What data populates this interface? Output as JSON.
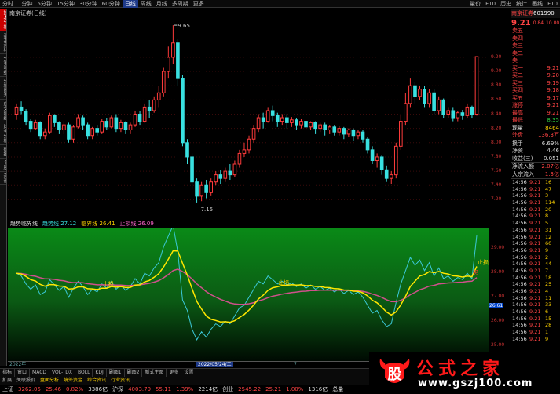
{
  "topbar": {
    "menu": [
      "分时",
      "1分钟",
      "5分钟",
      "15分钟",
      "30分钟",
      "60分钟",
      "日线",
      "周线",
      "月线",
      "多周期",
      "更多"
    ],
    "active": "日线",
    "right": [
      "量价",
      "F10",
      "历史",
      "统计",
      "画线",
      "F10"
    ]
  },
  "left_nav": [
    "技术分析",
    "基本资料",
    "分笔明细",
    "分析图表",
    "成交明细",
    "财务分析",
    "研报",
    "个股",
    "资讯"
  ],
  "left_nav_active": "技术分析",
  "chart": {
    "title": "南京证券(日线)",
    "price_labels": [
      "9.20",
      "9.00",
      "8.80",
      "8.60",
      "8.40",
      "8.20",
      "8.00",
      "7.80",
      "7.60",
      "7.40",
      "7.20"
    ],
    "high_label": "9.65",
    "low_label": "7.15",
    "candles": [
      [
        8.4,
        8.5,
        8.32,
        8.55
      ],
      [
        8.5,
        8.45,
        8.4,
        8.58
      ],
      [
        8.44,
        8.3,
        8.25,
        8.47
      ],
      [
        8.3,
        8.2,
        8.15,
        8.33
      ],
      [
        8.2,
        8.28,
        8.18,
        8.32
      ],
      [
        8.28,
        8.1,
        8.05,
        8.3
      ],
      [
        8.1,
        8.15,
        8.05,
        8.2
      ],
      [
        8.15,
        8.38,
        8.12,
        8.42
      ],
      [
        8.38,
        8.28,
        8.22,
        8.4
      ],
      [
        8.28,
        8.18,
        8.12,
        8.3
      ],
      [
        8.18,
        8.25,
        8.12,
        8.3
      ],
      [
        8.25,
        8.05,
        8.0,
        8.28
      ],
      [
        8.05,
        8.22,
        8.0,
        8.25
      ],
      [
        8.22,
        8.35,
        8.2,
        8.4
      ],
      [
        8.35,
        8.25,
        8.18,
        8.38
      ],
      [
        8.25,
        8.1,
        8.05,
        8.28
      ],
      [
        8.1,
        8.2,
        8.05,
        8.22
      ],
      [
        8.2,
        8.15,
        8.1,
        8.25
      ],
      [
        8.15,
        8.3,
        8.12,
        8.33
      ],
      [
        8.3,
        8.22,
        8.18,
        8.35
      ],
      [
        8.22,
        8.35,
        8.2,
        8.38
      ],
      [
        8.35,
        8.2,
        8.15,
        8.4
      ],
      [
        8.2,
        8.28,
        8.15,
        8.32
      ],
      [
        8.28,
        8.18,
        8.12,
        8.3
      ],
      [
        8.18,
        8.25,
        8.12,
        8.28
      ],
      [
        8.25,
        8.4,
        8.22,
        8.45
      ],
      [
        8.4,
        8.3,
        8.25,
        8.45
      ],
      [
        8.3,
        8.5,
        8.28,
        8.55
      ],
      [
        8.5,
        8.45,
        8.35,
        8.6
      ],
      [
        8.45,
        8.6,
        8.42,
        8.65
      ],
      [
        8.6,
        8.7,
        8.5,
        8.8
      ],
      [
        8.7,
        9.0,
        8.65,
        9.05
      ],
      [
        9.0,
        9.2,
        8.9,
        9.35
      ],
      [
        9.2,
        9.4,
        9.1,
        9.65
      ],
      [
        9.4,
        8.9,
        8.8,
        9.45
      ],
      [
        8.9,
        8.0,
        7.95,
        8.95
      ],
      [
        8.0,
        7.8,
        7.7,
        8.05
      ],
      [
        7.8,
        7.45,
        7.35,
        7.85
      ],
      [
        7.45,
        7.25,
        7.15,
        7.5
      ],
      [
        7.25,
        7.4,
        7.18,
        7.45
      ],
      [
        7.4,
        7.3,
        7.22,
        7.48
      ],
      [
        7.3,
        7.45,
        7.25,
        7.5
      ],
      [
        7.45,
        7.55,
        7.4,
        7.6
      ],
      [
        7.55,
        7.5,
        7.42,
        7.62
      ],
      [
        7.5,
        7.6,
        7.45,
        7.65
      ],
      [
        7.6,
        7.55,
        7.48,
        7.7
      ],
      [
        7.55,
        7.7,
        7.52,
        7.75
      ],
      [
        7.7,
        7.85,
        7.65,
        7.9
      ],
      [
        7.85,
        7.9,
        7.8,
        8.0
      ],
      [
        7.9,
        8.05,
        7.85,
        8.1
      ],
      [
        8.05,
        8.2,
        8.0,
        8.25
      ],
      [
        8.2,
        8.35,
        8.15,
        8.4
      ],
      [
        8.35,
        8.3,
        8.2,
        8.42
      ],
      [
        8.3,
        8.45,
        8.28,
        8.5
      ],
      [
        8.45,
        8.38,
        8.3,
        8.52
      ],
      [
        8.38,
        8.3,
        8.22,
        8.42
      ],
      [
        8.3,
        8.35,
        8.25,
        8.4
      ],
      [
        8.35,
        8.28,
        8.2,
        8.4
      ],
      [
        8.28,
        8.32,
        8.22,
        8.36
      ],
      [
        8.32,
        8.25,
        8.18,
        8.35
      ],
      [
        8.25,
        8.3,
        8.2,
        8.33
      ],
      [
        8.3,
        8.22,
        8.15,
        8.33
      ],
      [
        8.22,
        8.28,
        8.18,
        8.3
      ],
      [
        8.28,
        8.2,
        8.12,
        8.3
      ],
      [
        8.2,
        8.25,
        8.15,
        8.28
      ],
      [
        8.25,
        8.18,
        8.1,
        8.28
      ],
      [
        8.18,
        8.22,
        8.12,
        8.25
      ],
      [
        8.22,
        8.15,
        8.1,
        8.25
      ],
      [
        8.15,
        8.2,
        8.1,
        8.23
      ],
      [
        8.2,
        8.12,
        8.05,
        8.22
      ],
      [
        8.12,
        8.18,
        8.08,
        8.2
      ],
      [
        8.18,
        8.1,
        8.02,
        8.2
      ],
      [
        8.1,
        8.15,
        8.05,
        8.18
      ],
      [
        8.15,
        8.05,
        8.0,
        8.18
      ],
      [
        8.05,
        7.9,
        7.85,
        8.08
      ],
      [
        7.9,
        7.75,
        7.7,
        7.95
      ],
      [
        7.75,
        7.8,
        7.65,
        7.85
      ],
      [
        7.8,
        7.62,
        7.55,
        7.82
      ],
      [
        7.62,
        7.5,
        7.45,
        7.68
      ],
      [
        7.5,
        7.55,
        7.42,
        7.6
      ],
      [
        7.55,
        7.95,
        7.5,
        8.0
      ],
      [
        7.95,
        8.3,
        7.9,
        8.4
      ],
      [
        8.3,
        8.55,
        8.25,
        8.7
      ],
      [
        8.55,
        8.8,
        8.5,
        8.9
      ],
      [
        8.8,
        8.65,
        8.55,
        8.85
      ],
      [
        8.65,
        8.75,
        8.6,
        8.8
      ],
      [
        8.75,
        8.55,
        8.5,
        8.8
      ],
      [
        8.55,
        8.7,
        8.5,
        8.75
      ],
      [
        8.7,
        8.45,
        8.4,
        8.75
      ],
      [
        8.45,
        8.6,
        8.4,
        8.65
      ],
      [
        8.6,
        8.4,
        8.35,
        8.62
      ],
      [
        8.4,
        8.45,
        8.35,
        8.5
      ],
      [
        8.45,
        8.35,
        8.3,
        8.5
      ],
      [
        8.35,
        8.42,
        8.3,
        8.45
      ],
      [
        8.42,
        8.38,
        8.32,
        8.46
      ],
      [
        8.38,
        8.5,
        8.35,
        8.55
      ],
      [
        8.5,
        8.4,
        8.35,
        8.52
      ],
      [
        8.4,
        9.21,
        8.38,
        9.21
      ]
    ]
  },
  "indicator": {
    "header": [
      {
        "text": "趋势临界线",
        "color": "#ddd"
      },
      {
        "text": "趋势线 27.12",
        "color": "#39e0e0"
      },
      {
        "text": "临界线 26.41",
        "color": "#ffd400"
      },
      {
        "text": "止损线 26.09",
        "color": "#ff66cc"
      }
    ],
    "y_labels": [
      "29.00",
      "28.00",
      "27.00",
      "26.00",
      "25.00"
    ],
    "current_value": "26.61",
    "markers": [
      {
        "text": "止损",
        "color": "#ffd400"
      },
      {
        "text": "止损",
        "color": "#ffd400"
      },
      {
        "text": "止损",
        "color": "#ffd400"
      },
      {
        "text": "买",
        "color": "#ff3333"
      }
    ]
  },
  "time_axis": [
    "2022年",
    "2022/05/24/二",
    "7"
  ],
  "bottom_tabs": [
    "指标",
    "窗口",
    "MACD",
    "VOL-TDX",
    "BOLL",
    "KDJ",
    "副图1",
    "副图2",
    "新式主图",
    "更多",
    "设置"
  ],
  "bottom_tabs2": [
    "扩展",
    "关联报价",
    "盘面分析",
    "境外资金",
    "综合资讯",
    "行业资讯"
  ],
  "status_bar": [
    {
      "text": "上证",
      "color": "#ddd"
    },
    {
      "text": "3262.05",
      "color": "#ff4444"
    },
    {
      "text": "25.46",
      "color": "#ff4444"
    },
    {
      "text": "0.82%",
      "color": "#ff4444"
    },
    {
      "text": "3386亿",
      "color": "#ddd"
    },
    {
      "text": "沪深",
      "color": "#ddd"
    },
    {
      "text": "4003.79",
      "color": "#ff4444"
    },
    {
      "text": "55.11",
      "color": "#ff4444"
    },
    {
      "text": "1.39%",
      "color": "#ff4444"
    },
    {
      "text": "2214亿",
      "color": "#ddd"
    },
    {
      "text": "创业",
      "color": "#ddd"
    },
    {
      "text": "2545.22",
      "color": "#ff4444"
    },
    {
      "text": "25.21",
      "color": "#ff4444"
    },
    {
      "text": "1.00%",
      "color": "#ff4444"
    },
    {
      "text": "1316亿",
      "color": "#ddd"
    },
    {
      "text": "总量",
      "color": "#ddd"
    }
  ],
  "quote_panel": {
    "name": "南京证券",
    "code": "601990",
    "price": "9.21",
    "change": "0.84",
    "pct": "10.00",
    "rows": [
      {
        "l": "卖五",
        "v": "",
        "c": "red"
      },
      {
        "l": "卖四",
        "v": "",
        "c": "red"
      },
      {
        "l": "卖三",
        "v": "",
        "c": "red"
      },
      {
        "l": "卖二",
        "v": "",
        "c": "red"
      },
      {
        "l": "卖一",
        "v": "",
        "c": "red"
      },
      {
        "l": "买一",
        "v": "9.21",
        "c": "red"
      },
      {
        "l": "买二",
        "v": "9.20",
        "c": "red"
      },
      {
        "l": "买三",
        "v": "9.19",
        "c": "red"
      },
      {
        "l": "买四",
        "v": "9.18",
        "c": "red"
      },
      {
        "l": "买五",
        "v": "9.17",
        "c": "red"
      },
      {
        "l": "涨停",
        "v": "9.21",
        "c": "red"
      },
      {
        "l": "最高",
        "v": "9.21",
        "c": "red"
      },
      {
        "l": "最低",
        "v": "8.35",
        "c": "grn"
      },
      {
        "l": "现量",
        "v": "8464",
        "c": "ylw"
      },
      {
        "l": "外盘",
        "v": "136.3万",
        "c": "red"
      }
    ],
    "rows2": [
      {
        "l": "换手",
        "v": "6.69%",
        "c": "wht"
      },
      {
        "l": "净资",
        "v": "4.46",
        "c": "wht"
      },
      {
        "l": "收益(三)",
        "v": "0.051",
        "c": "wht"
      }
    ],
    "flow": [
      {
        "l": "净流入额",
        "v": "2.07亿",
        "c": "red"
      },
      {
        "l": "大宗流入",
        "v": "1.3亿",
        "c": "red"
      }
    ],
    "trades": [
      [
        "14:56",
        "9.21",
        "16"
      ],
      [
        "14:56",
        "9.21",
        "47"
      ],
      [
        "14:56",
        "9.21",
        "3"
      ],
      [
        "14:56",
        "9.21",
        "114"
      ],
      [
        "14:56",
        "9.21",
        "20"
      ],
      [
        "14:56",
        "9.21",
        "8"
      ],
      [
        "14:56",
        "9.21",
        "5"
      ],
      [
        "14:56",
        "9.21",
        "31"
      ],
      [
        "14:56",
        "9.21",
        "12"
      ],
      [
        "14:56",
        "9.21",
        "60"
      ],
      [
        "14:56",
        "9.21",
        "9"
      ],
      [
        "14:56",
        "9.21",
        "2"
      ],
      [
        "14:56",
        "9.21",
        "44"
      ],
      [
        "14:56",
        "9.21",
        "7"
      ],
      [
        "14:56",
        "9.21",
        "18"
      ],
      [
        "14:56",
        "9.21",
        "25"
      ],
      [
        "14:56",
        "9.21",
        "4"
      ],
      [
        "14:56",
        "9.21",
        "11"
      ],
      [
        "14:56",
        "9.21",
        "33"
      ],
      [
        "14:56",
        "9.21",
        "6"
      ],
      [
        "14:56",
        "9.21",
        "15"
      ],
      [
        "14:56",
        "9.21",
        "28"
      ],
      [
        "14:56",
        "9.21",
        "1"
      ],
      [
        "14:56",
        "9.21",
        "9"
      ]
    ]
  },
  "watermark": {
    "logo_char": "股",
    "title": "公式之家",
    "url": "www.gszj100.com"
  }
}
